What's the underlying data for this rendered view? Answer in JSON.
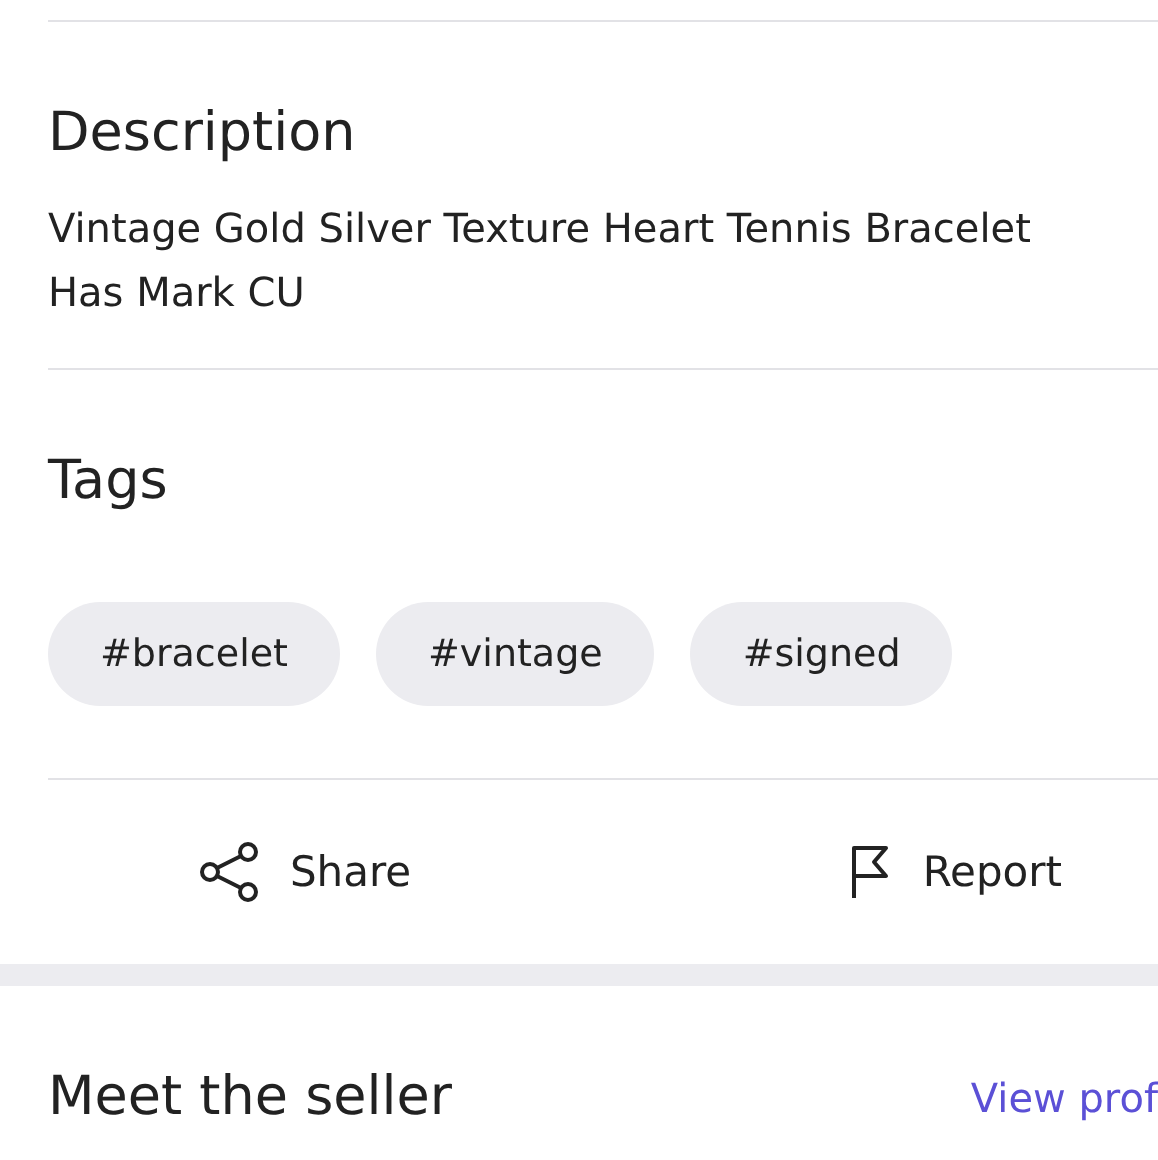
{
  "description": {
    "heading": "Description",
    "text": "Vintage Gold Silver Texture Heart Tennis Bracelet Has Mark CU"
  },
  "tags": {
    "heading": "Tags",
    "items": [
      "#bracelet",
      "#vintage",
      "#signed"
    ]
  },
  "actions": [
    {
      "kind": "share",
      "label": "Share"
    },
    {
      "kind": "report",
      "label": "Report"
    }
  ],
  "seller": {
    "heading": "Meet the seller",
    "link": "View prof"
  }
}
